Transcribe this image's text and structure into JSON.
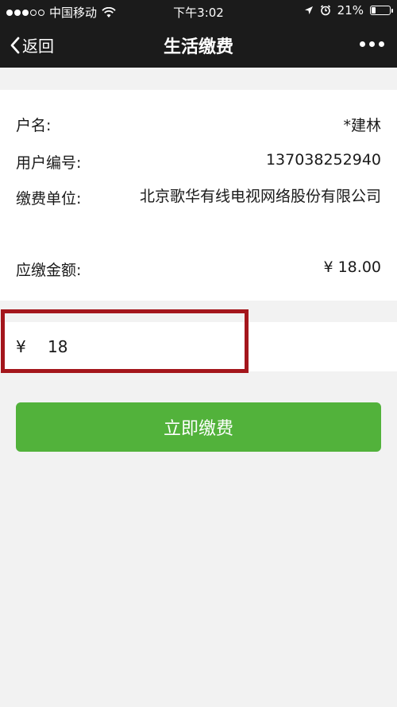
{
  "status_bar": {
    "carrier": "中国移动",
    "time": "下午3:02",
    "battery": "21%"
  },
  "nav": {
    "back_label": "返回",
    "title": "生活缴费"
  },
  "bill": {
    "account_name_label": "户名:",
    "account_name": "*建林",
    "user_id_label": "用户编号:",
    "user_id": "137038252940",
    "company_label": "缴费单位:",
    "company": "北京歌华有线电视网络股份有限公司",
    "amount_due_label": "应缴金额:",
    "amount_due": "¥ 18.00"
  },
  "payment": {
    "currency_symbol": "¥",
    "amount_value": "18"
  },
  "actions": {
    "pay_label": "立即缴费"
  },
  "colors": {
    "header_bg": "#1b1b1b",
    "pay_button": "#52b23b",
    "highlight_border": "#a4161c"
  }
}
